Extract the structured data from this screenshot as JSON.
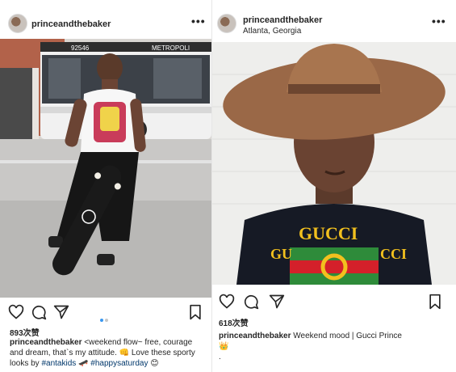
{
  "left_post": {
    "username": "princeandthebaker",
    "more_label": "•••",
    "photo_sign_text": "METROPOLI",
    "bus_number": "92546",
    "likes": "893次赞",
    "caption": {
      "username": "princeandthebaker",
      "text": "<weekend flow~ free, courage and dream, that`s my attitude. 👊 Love these sporty looks by",
      "hashtag1": "#antakids",
      "emoji": "🛹",
      "hashtag2": "#happysaturday",
      "end_emoji": "😊"
    },
    "carousel": {
      "count": 2,
      "active": 0
    }
  },
  "right_post": {
    "username": "princeandthebaker",
    "location": "Atlanta, Georgia",
    "more_label": "•••",
    "shirt_text_top": "GUCCI",
    "shirt_text_left": "GU",
    "shirt_text_right": "CCI",
    "likes": "618次赞",
    "caption": {
      "username": "princeandthebaker",
      "text": "Weekend mood | Gucci Prince",
      "emoji": "👑",
      "line2": "."
    }
  },
  "icons": [
    "heart-icon",
    "comment-icon",
    "share-icon",
    "bookmark-icon",
    "more-icon"
  ],
  "colors": {
    "link_blue": "#00376b",
    "active_dot": "#3897f0",
    "text": "#262626",
    "shirt_red": "#d4202a",
    "shirt_green": "#2e8b3a",
    "shirt_gold": "#f2c01e"
  }
}
